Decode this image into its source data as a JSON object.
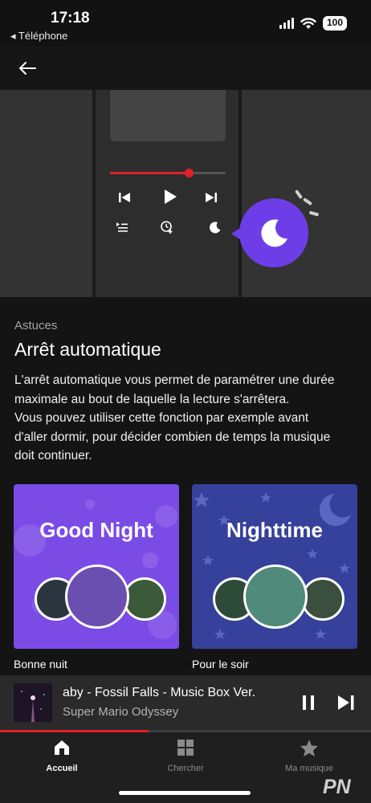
{
  "status_bar": {
    "time": "17:18",
    "back_app": "◂ Téléphone",
    "battery": "100"
  },
  "hero": {
    "progress": 0.68
  },
  "tip": {
    "label": "Astuces",
    "title": "Arrêt automatique",
    "lines": [
      "L'arrêt automatique vous permet de paramétrer une durée",
      "maximale au bout de laquelle la lecture s'arrêtera.",
      "Vous pouvez utiliser cette fonction par exemple avant",
      "d'aller dormir, pour décider combien de temps la musique",
      "doit continuer."
    ]
  },
  "playlists": [
    {
      "title": "Good Night",
      "caption": "Bonne nuit",
      "color": "#7b4be6"
    },
    {
      "title": "Nighttime",
      "caption": "Pour le soir",
      "color": "#35419a"
    }
  ],
  "player": {
    "title": "aby - Fossil Falls - Music Box Ver.",
    "subtitle": "Super Mario Odyssey",
    "progress": 0.4
  },
  "tabs": [
    {
      "label": "Accueil",
      "icon": "home-icon",
      "active": true
    },
    {
      "label": "Chercher",
      "icon": "grid-icon",
      "active": false
    },
    {
      "label": "Ma musique",
      "icon": "star-icon",
      "active": false
    }
  ],
  "watermark": "PN",
  "colors": {
    "accent_red": "#e3202a",
    "purple": "#6d3ee8"
  }
}
